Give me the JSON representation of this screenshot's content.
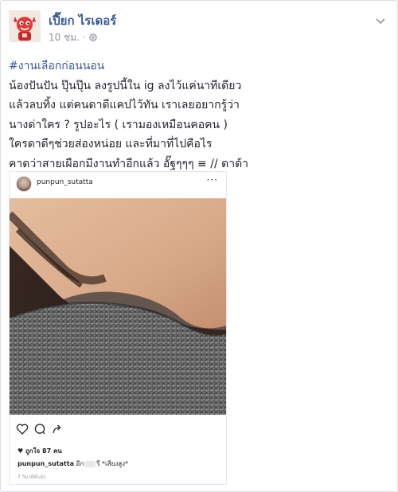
{
  "post": {
    "author": "เปี๊ยก ไรเดอร์",
    "time": "10 ชม.",
    "separator": "·",
    "hashtag": "#งานเลือกก่อนนอน",
    "lines": [
      "น้องปันปัน ปุ๊นปุ๊น ลงรูปนี้ใน ig ลงไว้แค่นาทีเดียว",
      "แล้วลบทิ้ง แต่คนดาดีแคปไว้ทัน เราเลยอยากรู้ว่า",
      "นางด่าใคร ? รูปอะไร ( เรามองเหมือนคอคน )",
      "ใครดาดีๆช่วยส่องหน่อย และที่มาที่ไปคือไร",
      "คาดว่าสายเผือกมีงานทำอีกแล้ว อั๊ฐๆๆๆ ≡ // ดาด้า"
    ]
  },
  "instagram": {
    "username": "punpun_sutatta",
    "more": "···",
    "likes": "♥ ถูกใจ 87 คน",
    "caption_user": "punpun_sutatta",
    "caption_pre": "อีก",
    "caption_post": "รี่ *เสียงสูง*",
    "time": "7 วินาทีที่แล้ว"
  },
  "colors": {
    "link": "#365899",
    "text": "#1d2129",
    "meta": "#90949c",
    "border": "#dddfe2"
  },
  "icons": [
    "avatar-devil-icon",
    "globe-icon",
    "chevron-down-icon",
    "heart-icon",
    "comment-icon",
    "share-icon"
  ]
}
